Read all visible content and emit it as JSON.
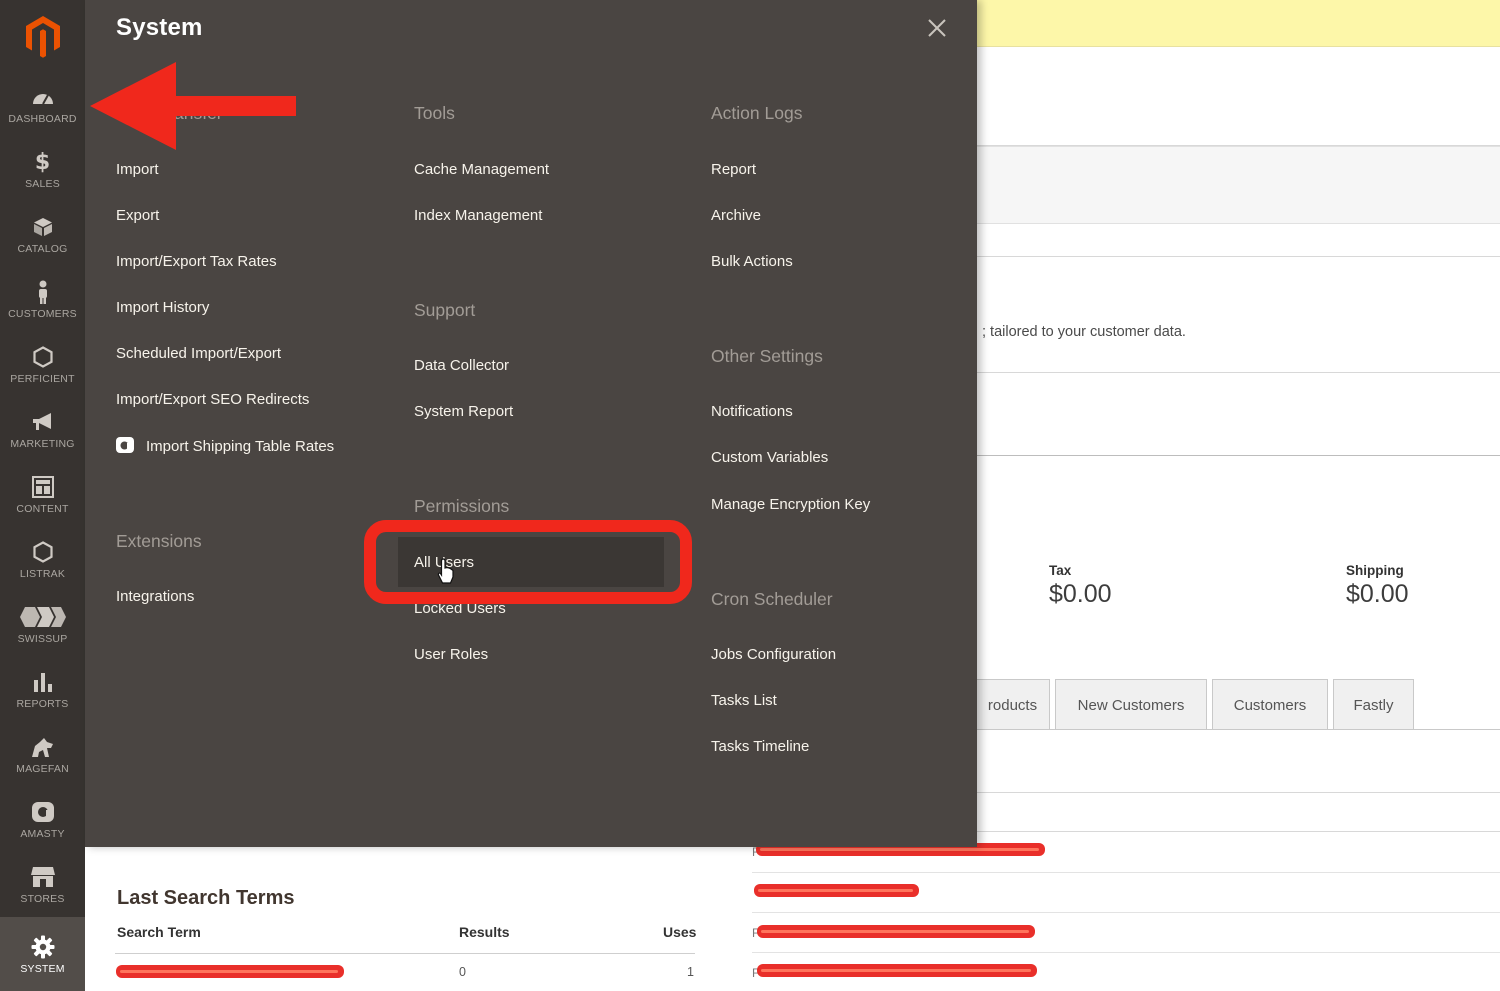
{
  "sidebar": {
    "logo": "magento-logo",
    "items": [
      {
        "label": "DASHBOARD",
        "icon": "dashboard-gauge-icon"
      },
      {
        "label": "SALES",
        "icon": "dollar-icon"
      },
      {
        "label": "CATALOG",
        "icon": "cube-icon"
      },
      {
        "label": "CUSTOMERS",
        "icon": "person-icon"
      },
      {
        "label": "PERFICIENT",
        "icon": "hexagon-icon"
      },
      {
        "label": "MARKETING",
        "icon": "megaphone-icon"
      },
      {
        "label": "CONTENT",
        "icon": "layout-icon"
      },
      {
        "label": "LISTRAK",
        "icon": "hexagon-icon"
      },
      {
        "label": "SWISSUP",
        "icon": "swissup-logo-icon"
      },
      {
        "label": "REPORTS",
        "icon": "bar-chart-icon"
      },
      {
        "label": "MAGEFAN",
        "icon": "magefan-logo-icon"
      },
      {
        "label": "AMASTY",
        "icon": "amasty-logo-icon"
      },
      {
        "label": "STORES",
        "icon": "store-icon"
      },
      {
        "label": "SYSTEM",
        "icon": "gear-icon"
      }
    ],
    "active": "SYSTEM"
  },
  "flyout": {
    "title": "System",
    "close_icon": "close-icon",
    "data_transfer": {
      "title_partial": "ansfer",
      "links": [
        "Import",
        "Export",
        "Import/Export Tax Rates",
        "Import History",
        "Scheduled Import/Export",
        "Import/Export SEO Redirects",
        "Import Shipping Table Rates"
      ]
    },
    "extensions": {
      "title": "Extensions",
      "links": [
        "Integrations"
      ]
    },
    "tools": {
      "title": "Tools",
      "links": [
        "Cache Management",
        "Index Management"
      ]
    },
    "support": {
      "title": "Support",
      "links": [
        "Data Collector",
        "System Report"
      ]
    },
    "permissions": {
      "title": "Permissions",
      "links": [
        "All Users",
        "Locked Users",
        "User Roles"
      ]
    },
    "action_logs": {
      "title": "Action Logs",
      "links": [
        "Report",
        "Archive",
        "Bulk Actions"
      ]
    },
    "other_settings": {
      "title": "Other Settings",
      "links": [
        "Notifications",
        "Custom Variables",
        "Manage Encryption Key"
      ]
    },
    "cron_scheduler": {
      "title": "Cron Scheduler",
      "links": [
        "Jobs Configuration",
        "Tasks List",
        "Tasks Timeline"
      ]
    }
  },
  "dashboard": {
    "promo_text": "; tailored to your customer data.",
    "tax": {
      "label": "Tax",
      "value": "$0.00"
    },
    "shipping": {
      "label": "Shipping",
      "value": "$0.00"
    },
    "tabs": [
      "roducts",
      "New Customers",
      "Customers",
      "Fastly"
    ],
    "last_search": {
      "title": "Last Search Terms",
      "columns": [
        "Search Term",
        "Results",
        "Uses"
      ],
      "row": {
        "results": "0",
        "uses": "1"
      }
    },
    "row_prefix": "F"
  },
  "colors": {
    "sidebar_bg": "#373330",
    "flyout_bg": "#4a4542",
    "accent": "#eb5202",
    "annotation_red": "#f0281c",
    "notice_yellow": "#fdf7a9"
  }
}
